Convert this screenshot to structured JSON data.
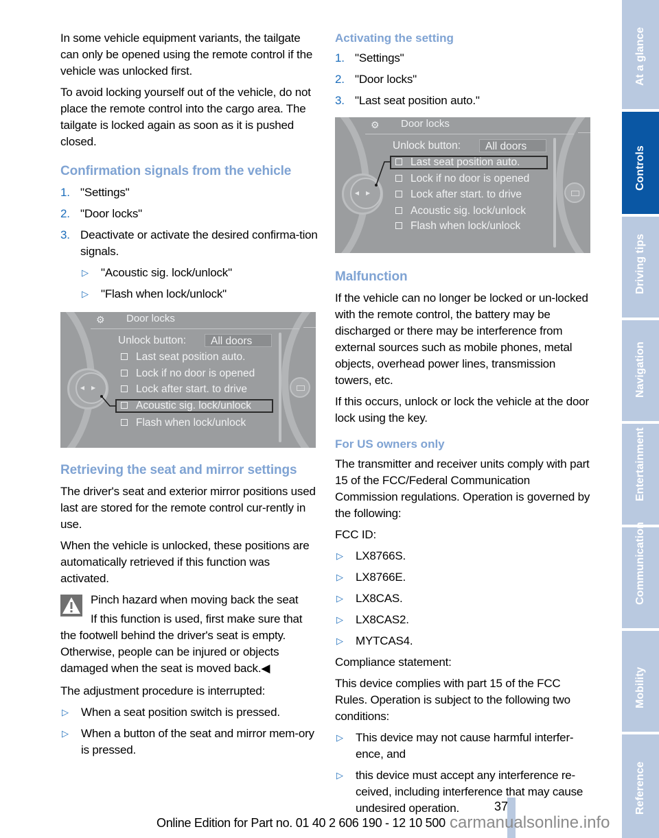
{
  "left_column": {
    "intro_paragraphs": [
      "In some vehicle equipment variants, the tailgate can only be opened using the remote control if the vehicle was unlocked first.",
      "To avoid locking yourself out of the vehicle, do not place the remote control into the cargo area. The tailgate is locked again as soon as it is pushed closed."
    ],
    "confirmation": {
      "heading": "Confirmation signals from the vehicle",
      "steps": [
        {
          "num": "1.",
          "text": "\"Settings\""
        },
        {
          "num": "2.",
          "text": "\"Door locks\""
        },
        {
          "num": "3.",
          "text": "Deactivate or activate the desired confirma-tion signals."
        }
      ],
      "sub_bullets": [
        "\"Acoustic sig. lock/unlock\"",
        "\"Flash when lock/unlock\""
      ]
    },
    "screen1": {
      "title": "Door locks",
      "unlock_label": "Unlock button:",
      "unlock_value": "All doors",
      "options": [
        "Last seat position auto.",
        "Lock if no door is opened",
        "Lock after start. to drive",
        "Acoustic sig. lock/unlock",
        "Flash when lock/unlock"
      ],
      "highlighted": "Acoustic sig. lock/unlock"
    },
    "retrieving": {
      "heading": "Retrieving the seat and mirror settings",
      "paragraphs": [
        "The driver's seat and exterior mirror positions used last are stored for the remote control cur-rently in use.",
        "When the vehicle is unlocked, these positions are automatically retrieved if this function was activated."
      ],
      "warning_title": "Pinch hazard when moving back the seat",
      "warning_text_indent": "If this function is used, first make sure that",
      "warning_text_rest": "the footwell behind the driver's seat is empty. Otherwise, people can be injured or objects damaged when the seat is moved back.◀",
      "interrupted_intro": "The adjustment procedure is interrupted:",
      "interrupted_bullets": [
        "When a seat position switch is pressed.",
        "When a button of the seat and mirror mem-ory is pressed."
      ]
    }
  },
  "right_column": {
    "activating": {
      "heading": "Activating the setting",
      "steps": [
        {
          "num": "1.",
          "text": "\"Settings\""
        },
        {
          "num": "2.",
          "text": "\"Door locks\""
        },
        {
          "num": "3.",
          "text": "\"Last seat position auto.\""
        }
      ]
    },
    "screen2": {
      "title": "Door locks",
      "unlock_label": "Unlock button:",
      "unlock_value": "All doors",
      "options": [
        "Last seat position auto.",
        "Lock if no door is opened",
        "Lock after start. to drive",
        "Acoustic sig. lock/unlock",
        "Flash when lock/unlock"
      ],
      "highlighted": "Last seat position auto."
    },
    "malfunction": {
      "heading": "Malfunction",
      "paragraphs": [
        "If the vehicle can no longer be locked or un-locked with the remote control, the battery may be discharged or there may be interference from external sources such as mobile phones, metal objects, overhead power lines, transmission towers, etc.",
        "If this occurs, unlock or lock the vehicle at the door lock using the key."
      ]
    },
    "us_owners": {
      "heading": "For US owners only",
      "paragraph": "The transmitter and receiver units comply with part 15 of the FCC/Federal Communication Commission regulations. Operation is governed by the following:",
      "fcc_label": "FCC ID:",
      "fcc_ids": [
        "LX8766S.",
        "LX8766E.",
        "LX8CAS.",
        "LX8CAS2.",
        "MYTCAS4."
      ],
      "compliance_label": "Compliance statement:",
      "compliance_text": "This device complies with part 15 of the FCC Rules. Operation is subject to the following two conditions:",
      "conditions": [
        "This device may not cause harmful interfer-ence, and",
        "this device must accept any interference re-ceived, including interference that may cause undesired operation."
      ]
    }
  },
  "sidebar": {
    "tabs": [
      {
        "label": "At a glance",
        "active": false
      },
      {
        "label": "Controls",
        "active": true
      },
      {
        "label": "Driving tips",
        "active": false
      },
      {
        "label": "Navigation",
        "active": false
      },
      {
        "label": "Entertainment",
        "active": false
      },
      {
        "label": "Communication",
        "active": false
      },
      {
        "label": "Mobility",
        "active": false
      },
      {
        "label": "Reference",
        "active": false
      }
    ],
    "active_color": "#0a57a4",
    "inactive_color": "#b9c9e0"
  },
  "footer": {
    "page_number": "37",
    "edition": "Online Edition for Part no. 01 40 2 606 190 - 12 10 500",
    "watermark": "carmanualsonline.info"
  }
}
